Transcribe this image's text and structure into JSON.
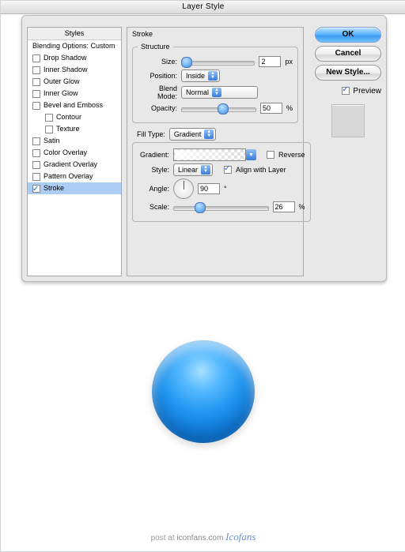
{
  "window": {
    "title": "Layer Style"
  },
  "sidebar": {
    "header": "Styles",
    "blending": "Blending Options: Custom",
    "items": [
      {
        "label": "Drop Shadow",
        "on": false,
        "sub": false
      },
      {
        "label": "Inner Shadow",
        "on": false,
        "sub": false
      },
      {
        "label": "Outer Glow",
        "on": false,
        "sub": false
      },
      {
        "label": "Inner Glow",
        "on": false,
        "sub": false
      },
      {
        "label": "Bevel and Emboss",
        "on": false,
        "sub": false
      },
      {
        "label": "Contour",
        "on": false,
        "sub": true
      },
      {
        "label": "Texture",
        "on": false,
        "sub": true
      },
      {
        "label": "Satin",
        "on": false,
        "sub": false
      },
      {
        "label": "Color Overlay",
        "on": false,
        "sub": false
      },
      {
        "label": "Gradient Overlay",
        "on": false,
        "sub": false
      },
      {
        "label": "Pattern Overlay",
        "on": false,
        "sub": false
      },
      {
        "label": "Stroke",
        "on": true,
        "sub": false,
        "active": true
      }
    ]
  },
  "buttons": {
    "ok": "OK",
    "cancel": "Cancel",
    "newstyle": "New Style...",
    "preview_label": "Preview",
    "preview_on": true
  },
  "stroke": {
    "title": "Stroke",
    "structure": "Structure",
    "size_label": "Size:",
    "size_val": "2",
    "size_unit": "px",
    "position_label": "Position:",
    "position_val": "Inside",
    "blend_label": "Blend Mode:",
    "blend_val": "Normal",
    "opacity_label": "Opacity:",
    "opacity_val": "50",
    "opacity_unit": "%",
    "fill_label": "Fill Type:",
    "fill_val": "Gradient",
    "gradient_label": "Gradient:",
    "reverse_label": "Reverse",
    "style_label": "Style:",
    "style_val": "Linear",
    "align_label": "Align with Layer",
    "angle_label": "Angle:",
    "angle_val": "90",
    "angle_unit": "°",
    "scale_label": "Scale:",
    "scale_val": "26",
    "scale_unit": "%"
  },
  "footer": {
    "prefix": "post at",
    "domain": "iconfans.com",
    "brand": "Icofans"
  }
}
